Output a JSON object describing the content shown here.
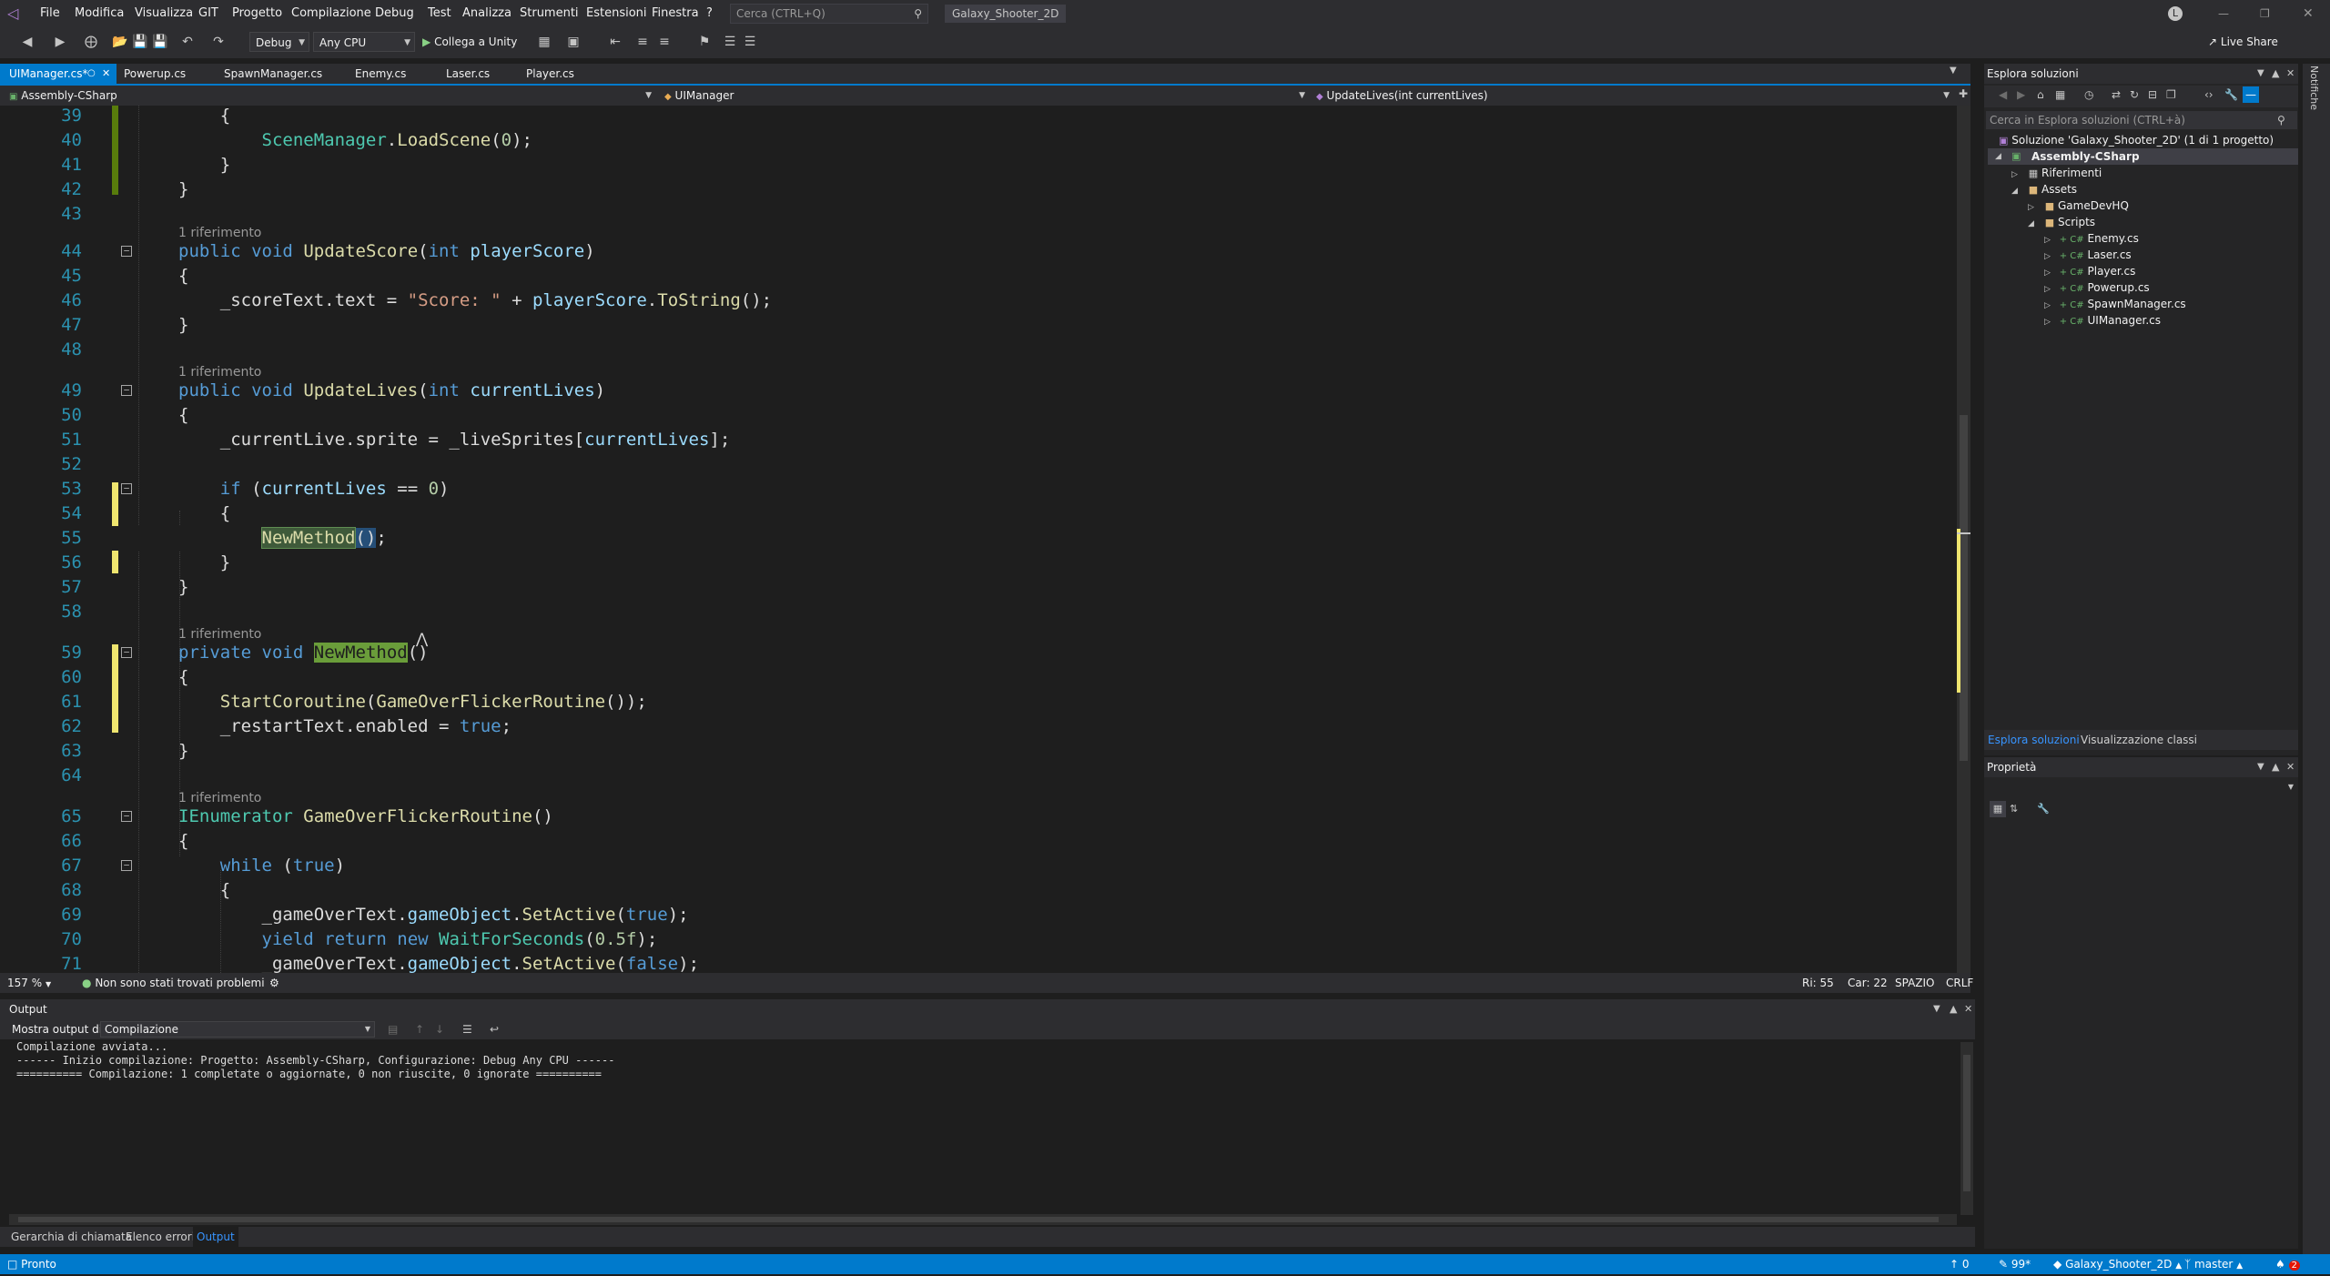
{
  "menu": {
    "items": [
      "File",
      "Modifica",
      "Visualizza",
      "GIT",
      "Progetto",
      "Compilazione",
      "Debug",
      "Test",
      "Analizza",
      "Strumenti",
      "Estensioni",
      "Finestra",
      "?"
    ],
    "search_placeholder": "Cerca (CTRL+Q)",
    "solution_name": "Galaxy_Shooter_2D",
    "user_initial": "L",
    "live_share": "Live Share"
  },
  "toolbar": {
    "config": "Debug",
    "platform": "Any CPU",
    "run_label": "Collega a Unity"
  },
  "tabs": [
    {
      "label": "UIManager.cs*",
      "active": true
    },
    {
      "label": "Powerup.cs",
      "active": false
    },
    {
      "label": "SpawnManager.cs",
      "active": false
    },
    {
      "label": "Enemy.cs",
      "active": false
    },
    {
      "label": "Laser.cs",
      "active": false
    },
    {
      "label": "Player.cs",
      "active": false
    }
  ],
  "navbar": {
    "project": "Assembly-CSharp",
    "class": "UIManager",
    "member": "UpdateLives(int currentLives)"
  },
  "code": {
    "ref_label": "1 riferimento",
    "line_numbers": [
      "39",
      "40",
      "41",
      "42",
      "43",
      "44",
      "45",
      "46",
      "47",
      "48",
      "49",
      "50",
      "51",
      "52",
      "53",
      "54",
      "55",
      "56",
      "57",
      "58",
      "59",
      "60",
      "61",
      "62",
      "63",
      "64",
      "65",
      "66",
      "67",
      "68",
      "69",
      "70",
      "71"
    ]
  },
  "editor_status": {
    "zoom": "157 %",
    "problems": "Non sono stati trovati problemi",
    "line": "Ri: 55",
    "col": "Car: 22",
    "spacing": "SPAZIO",
    "eol": "CRLF"
  },
  "output": {
    "title": "Output",
    "show_from_label": "Mostra output di:",
    "show_from_value": "Compilazione",
    "lines": [
      "Compilazione avviata...",
      "------ Inizio compilazione: Progetto: Assembly-CSharp, Configurazione: Debug Any CPU ------",
      "========== Compilazione: 1 completate o aggiornate, 0 non riuscite, 0 ignorate =========="
    ]
  },
  "bottom_tabs": [
    "Gerarchia di chiamata",
    "Elenco errori",
    "Output"
  ],
  "statusbar": {
    "ready": "Pronto",
    "up_count": "0",
    "pencil_count": "99*",
    "repo": "Galaxy_Shooter_2D",
    "branch": "master",
    "notif_count": "2"
  },
  "solution_explorer": {
    "title": "Esplora soluzioni",
    "search_placeholder": "Cerca in Esplora soluzioni (CTRL+à)",
    "items": [
      {
        "label": "Soluzione 'Galaxy_Shooter_2D' (1 di 1 progetto)"
      },
      {
        "label": "Assembly-CSharp"
      },
      {
        "label": "Riferimenti"
      },
      {
        "label": "Assets"
      },
      {
        "label": "GameDevHQ"
      },
      {
        "label": "Scripts"
      },
      {
        "label": "Enemy.cs"
      },
      {
        "label": "Laser.cs"
      },
      {
        "label": "Player.cs"
      },
      {
        "label": "Powerup.cs"
      },
      {
        "label": "SpawnManager.cs"
      },
      {
        "label": "UIManager.cs"
      }
    ],
    "bottom_tabs": [
      "Esplora soluzioni",
      "Visualizzazione classi"
    ]
  },
  "properties": {
    "title": "Proprietà"
  },
  "notifications_label": "Notifiche",
  "colors": {
    "accent": "#007acc",
    "editor_bg": "#1e1e1e",
    "chrome_bg": "#2d2d30"
  }
}
